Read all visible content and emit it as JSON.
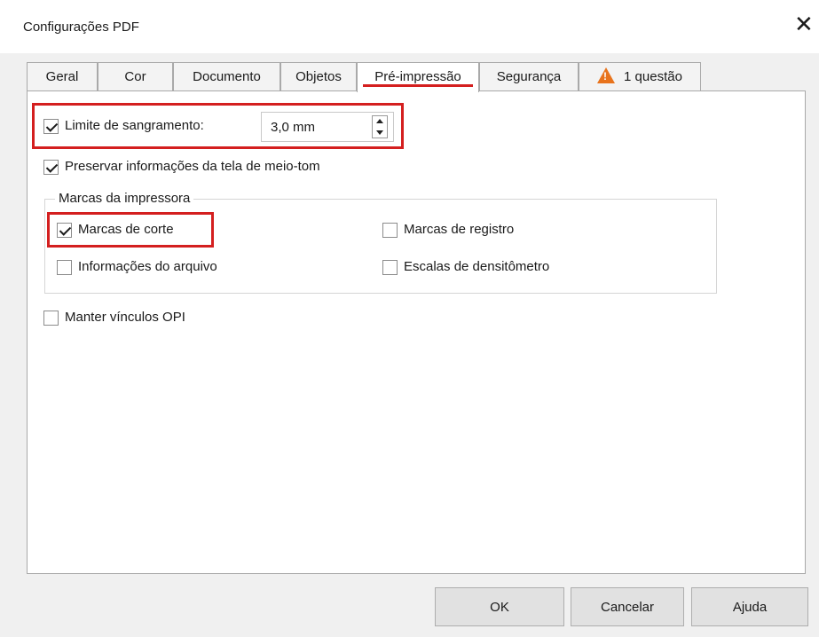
{
  "window": {
    "title": "Configurações PDF",
    "close_glyph": "✕"
  },
  "tabs": [
    {
      "label": "Geral"
    },
    {
      "label": "Cor"
    },
    {
      "label": "Documento"
    },
    {
      "label": "Objetos"
    },
    {
      "label": "Pré-impressão",
      "active": true
    },
    {
      "label": "Segurança"
    },
    {
      "label": "1 questão",
      "icon": "warning-icon"
    }
  ],
  "bleed": {
    "label": "Limite de sangramento:",
    "checked": true,
    "value": "3,0 mm"
  },
  "halftone": {
    "label": "Preservar informações da tela de meio-tom",
    "checked": true
  },
  "printer_marks": {
    "title": "Marcas da impressora",
    "items": [
      {
        "label": "Marcas de corte",
        "checked": true
      },
      {
        "label": "Marcas de registro",
        "checked": false
      },
      {
        "label": "Informações do arquivo",
        "checked": false
      },
      {
        "label": "Escalas de densitômetro",
        "checked": false
      }
    ]
  },
  "opi": {
    "label": "Manter vínculos OPI",
    "checked": false
  },
  "buttons": {
    "ok": "OK",
    "cancel": "Cancelar",
    "help": "Ajuda"
  },
  "colors": {
    "highlight": "#d41f1f",
    "warning": "#e8731c"
  }
}
